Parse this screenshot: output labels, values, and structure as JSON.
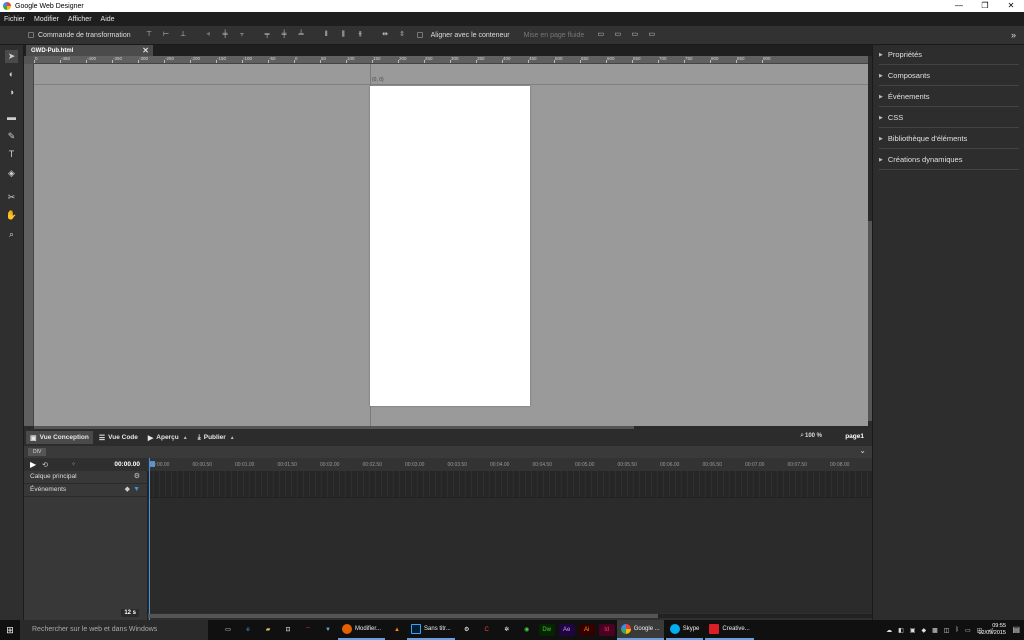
{
  "window": {
    "title": "Google Web Designer",
    "minimize": "—",
    "maximize": "❐",
    "close": "✕"
  },
  "menu": [
    "Fichier",
    "Modifier",
    "Afficher",
    "Aide"
  ],
  "toolbar": {
    "transform_label": "Commande de transformation",
    "align_container_label": "Aligner avec le conteneur",
    "fluid_layout_label": "Mise en page fluide",
    "expand_icon": "»"
  },
  "doc_tab": {
    "name": "GWD-Pub.html",
    "close": "✕"
  },
  "ruler_labels": [
    "0",
    "-450",
    "-400",
    "-350",
    "-300",
    "-250",
    "-200",
    "-150",
    "-100",
    "-50",
    "0",
    "50",
    "100",
    "150",
    "200",
    "250",
    "300",
    "350",
    "400",
    "450",
    "500",
    "550",
    "600",
    "650",
    "700",
    "750",
    "800",
    "850",
    "900"
  ],
  "canvas": {
    "coord_readout": "(0, 0)"
  },
  "viewbar": {
    "design_view": "Vue Conception",
    "code_view": "Vue Code",
    "preview": "Aperçu",
    "publish": "Publier",
    "zoom": "100 %",
    "page": "page1"
  },
  "timeline": {
    "element_chip": "DIV",
    "time": "00:00.00",
    "layers": [
      {
        "label": "Calque principal",
        "icon": "⚙"
      },
      {
        "label": "Événements",
        "icon": "◆"
      }
    ],
    "duration": "12 s",
    "ruler_labels": [
      "00:00.00",
      "00:00.50",
      "00:01.00",
      "00:01.50",
      "00:02.00",
      "00:02.50",
      "00:03.00",
      "00:03.50",
      "00:04.00",
      "00:04.50",
      "00:05.00",
      "00:05.50",
      "00:06.00",
      "00:06.50",
      "00:07.00",
      "00:07.50",
      "00:08.00"
    ]
  },
  "right_panel": [
    "Propriétés",
    "Composants",
    "Événements",
    "CSS",
    "Bibliothèque d'éléments",
    "Créations dynamiques"
  ],
  "taskbar": {
    "search_placeholder": "Rechercher sur le web et dans Windows",
    "apps": [
      {
        "label": "Modifier...",
        "color": "#e66000"
      },
      {
        "label": "Sans titr...",
        "color": "#001d34"
      },
      {
        "label": "Google ...",
        "color": "#4285f4"
      },
      {
        "label": "Skype",
        "color": "#00aff0"
      },
      {
        "label": "Creative...",
        "color": "#da1f26"
      }
    ],
    "clock_time": "09:55",
    "clock_date": "02/09/2015"
  }
}
